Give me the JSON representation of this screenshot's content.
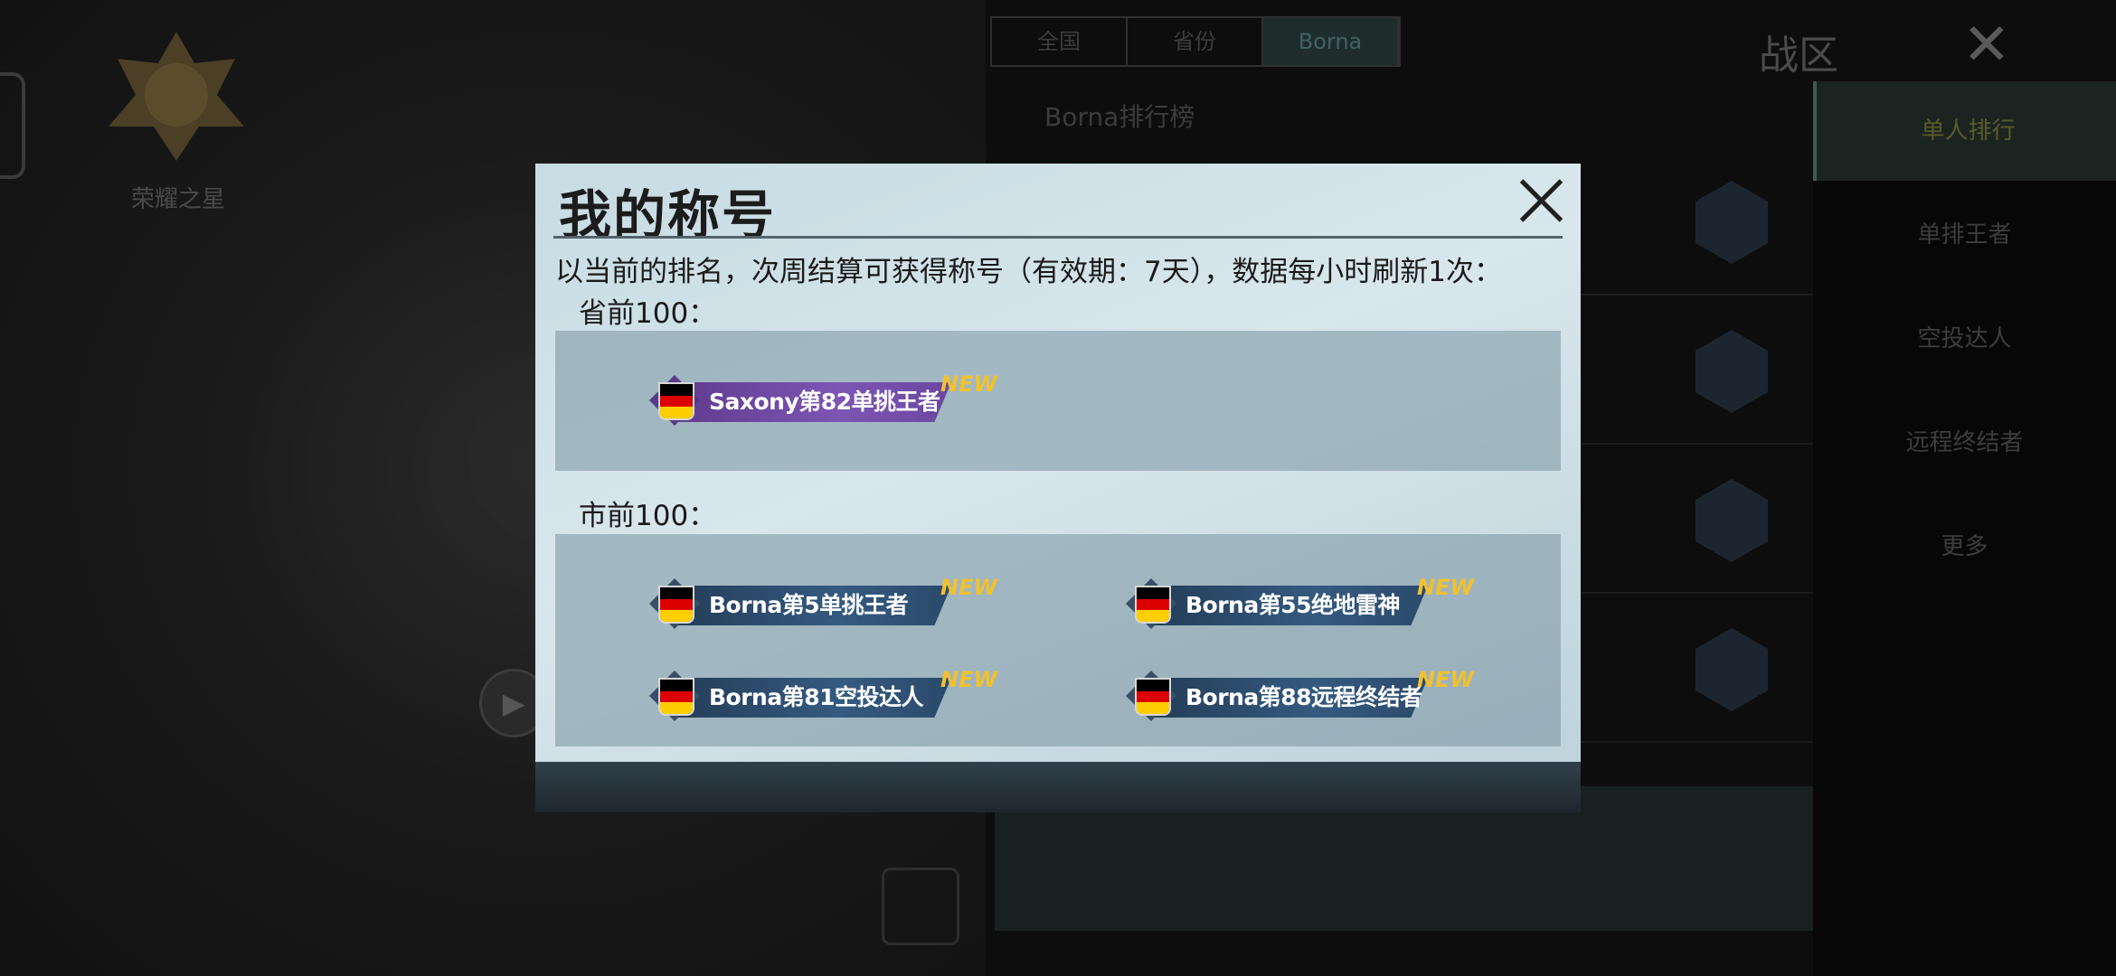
{
  "background": {
    "rank_badge_label": "荣耀之星",
    "tabs": [
      "全国",
      "省份",
      "Borna"
    ],
    "region_label": "战区",
    "location_text": "Borna排行榜",
    "side_items": [
      "单人排行",
      "单排王者",
      "空投达人",
      "远程终结者",
      "更多"
    ],
    "colors": {
      "accent": "#41625f"
    }
  },
  "dialog": {
    "title": "我的称号",
    "notice": "以当前的排名，次周结算可获得称号（有效期：7天），数据每小时刷新1次：",
    "province_section": {
      "label": "省前100：",
      "badges": [
        {
          "text": "Saxony第82单挑王者",
          "new": "NEW",
          "style": "purple"
        }
      ]
    },
    "city_section": {
      "label": "市前100：",
      "badges": [
        {
          "text": "Borna第5单挑王者",
          "new": "NEW",
          "style": "blue"
        },
        {
          "text": "Borna第55绝地雷神",
          "new": "NEW",
          "style": "blue"
        },
        {
          "text": "Borna第81空投达人",
          "new": "NEW",
          "style": "blue"
        },
        {
          "text": "Borna第88远程终结者",
          "new": "NEW",
          "style": "blue"
        }
      ]
    },
    "icons": {
      "close": "close-icon",
      "flag": "germany-flag-icon"
    },
    "colors": {
      "new_badge": "#f2c12e",
      "purple_title": "#6b48a2",
      "blue_title": "#2e4d6e"
    }
  }
}
